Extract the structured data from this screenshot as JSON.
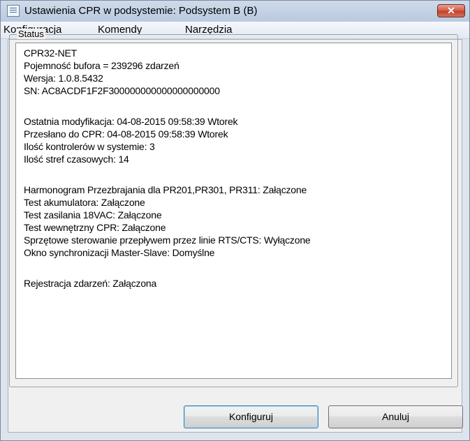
{
  "window": {
    "title": "Ustawienia CPR w podsystemie: Podsystem B (B)",
    "close_glyph": "✕"
  },
  "menu": {
    "items": [
      "Konfiguracja",
      "Komendy",
      "Narzędzia"
    ]
  },
  "status": {
    "legend": "Status",
    "lines": [
      "CPR32-NET",
      "Pojemność bufora = 239296 zdarzeń",
      "Wersja: 1.0.8.5432",
      "SN: AC8ACDF1F2F300000000000000000000",
      "Ostatnia modyfikacja: 04-08-2015   09:58:39    Wtorek",
      "Przesłano do CPR: 04-08-2015   09:58:39    Wtorek",
      "Ilość kontrolerów w systemie: 3",
      "Ilość stref czasowych: 14",
      "Harmonogram Przezbrajania dla PR201,PR301, PR311: Załączone",
      "Test akumulatora: Załączone",
      "Test zasilania 18VAC: Załączone",
      "Test wewnętrzny CPR: Załączone",
      "Sprzętowe sterowanie przepływem przez linie RTS/CTS: Wyłączone",
      "Okno synchronizacji Master-Slave: Domyślne",
      "Rejestracja zdarzeń:  Załączona"
    ]
  },
  "buttons": {
    "configure": "Konfiguruj",
    "cancel": "Anuluj"
  },
  "icons": {
    "app": "app-window-icon",
    "close": "close-icon"
  }
}
